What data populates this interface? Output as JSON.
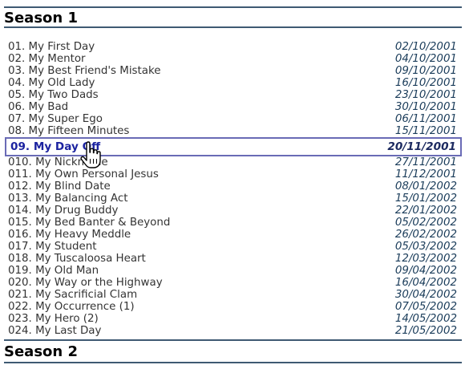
{
  "season1": {
    "title": "Season 1"
  },
  "season2": {
    "title": "Season 2"
  },
  "episodes": [
    {
      "name": "01. My First Day",
      "date": "02/10/2001"
    },
    {
      "name": "02. My Mentor",
      "date": "04/10/2001"
    },
    {
      "name": "03. My Best Friend's Mistake",
      "date": "09/10/2001"
    },
    {
      "name": "04. My Old Lady",
      "date": "16/10/2001"
    },
    {
      "name": "05. My Two Dads",
      "date": "23/10/2001"
    },
    {
      "name": "06. My Bad",
      "date": "30/10/2001"
    },
    {
      "name": "07. My Super Ego",
      "date": "06/11/2001"
    },
    {
      "name": "08. My Fifteen Minutes",
      "date": "15/11/2001"
    },
    {
      "name": "09. My Day Off",
      "date": "20/11/2001"
    },
    {
      "name": "010. My Nickname",
      "date": "27/11/2001"
    },
    {
      "name": "011. My Own Personal Jesus",
      "date": "11/12/2001"
    },
    {
      "name": "012. My Blind Date",
      "date": "08/01/2002"
    },
    {
      "name": "013. My Balancing Act",
      "date": "15/01/2002"
    },
    {
      "name": "014. My Drug Buddy",
      "date": "22/01/2002"
    },
    {
      "name": "015. My Bed Banter & Beyond",
      "date": "05/02/2002"
    },
    {
      "name": "016. My Heavy Meddle",
      "date": "26/02/2002"
    },
    {
      "name": "017. My Student",
      "date": "05/03/2002"
    },
    {
      "name": "018. My Tuscaloosa Heart",
      "date": "12/03/2002"
    },
    {
      "name": "019. My Old Man",
      "date": "09/04/2002"
    },
    {
      "name": "020. My Way or the Highway",
      "date": "16/04/2002"
    },
    {
      "name": "021. My Sacrificial Clam",
      "date": "30/04/2002"
    },
    {
      "name": "022. My Occurrence (1)",
      "date": "07/05/2002"
    },
    {
      "name": "023. My Hero (2)",
      "date": "14/05/2002"
    },
    {
      "name": "024. My Last Day",
      "date": "21/05/2002"
    }
  ],
  "selected_index": 8,
  "colors": {
    "header_rule": "#3f5a73",
    "selected_border": "#6a6bb6",
    "selected_text": "#1c23a0",
    "date_text": "#1a3c5a"
  },
  "cursor": {
    "icon": "hand-pointer-icon"
  }
}
